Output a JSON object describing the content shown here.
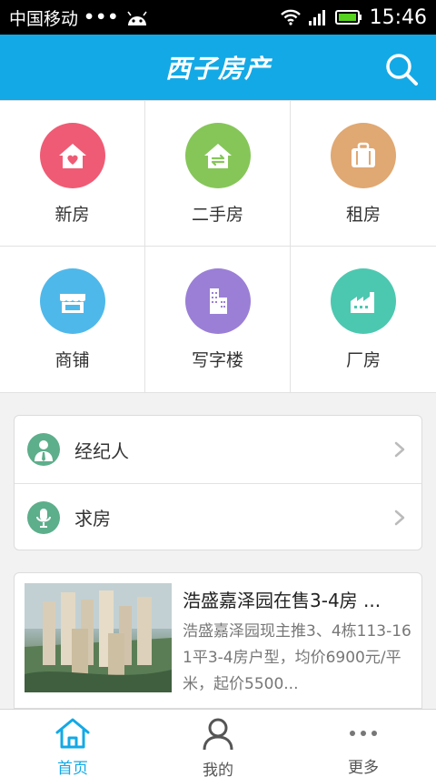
{
  "status_bar": {
    "carrier": "中国移动",
    "dots": "•••",
    "time": "15:46"
  },
  "header": {
    "logo_text": "西子房产"
  },
  "grid": {
    "items": [
      {
        "label": "新房",
        "color": "#ef5b74",
        "icon": "house-heart-icon"
      },
      {
        "label": "二手房",
        "color": "#86c659",
        "icon": "house-exchange-icon"
      },
      {
        "label": "租房",
        "color": "#e0a872",
        "icon": "suitcase-icon"
      },
      {
        "label": "商铺",
        "color": "#4fb8ea",
        "icon": "shop-icon"
      },
      {
        "label": "写字楼",
        "color": "#9b7fd6",
        "icon": "office-building-icon"
      },
      {
        "label": "厂房",
        "color": "#4cc8b0",
        "icon": "factory-icon"
      }
    ]
  },
  "list": {
    "items": [
      {
        "label": "经纪人",
        "icon": "agent-icon"
      },
      {
        "label": "求房",
        "icon": "microphone-icon"
      }
    ]
  },
  "news": {
    "title": "浩盛嘉泽园在售3-4房 ...",
    "description": "浩盛嘉泽园现主推3、4栋113-161平3-4房户型，均价6900元/平米，起价5500..."
  },
  "tabbar": {
    "tabs": [
      {
        "label": "首页",
        "icon": "home-icon",
        "active": true
      },
      {
        "label": "我的",
        "icon": "user-icon",
        "active": false
      },
      {
        "label": "更多",
        "icon": "more-icon",
        "active": false
      }
    ]
  },
  "colors": {
    "accent": "#13a9e6",
    "list_icon": "#5dae8b"
  }
}
